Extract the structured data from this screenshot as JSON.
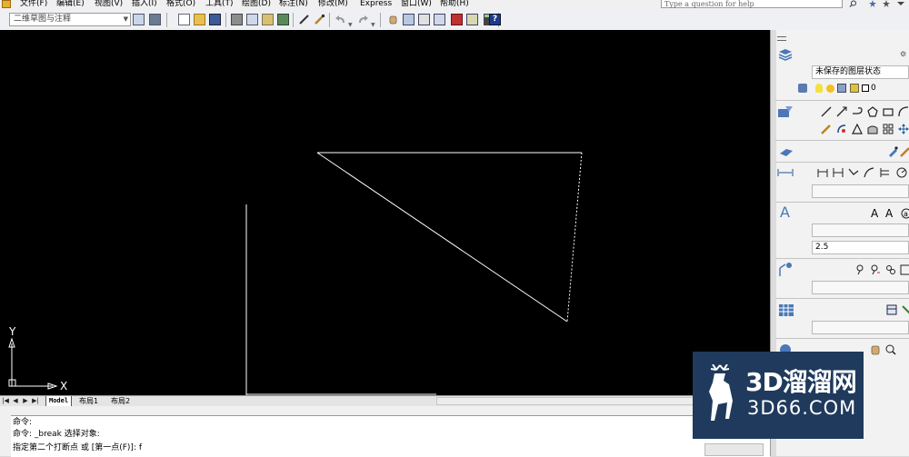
{
  "menubar": {
    "items": [
      "文件(F)",
      "编辑(E)",
      "视图(V)",
      "插入(I)",
      "格式(O)",
      "工具(T)",
      "绘图(D)",
      "标注(N)",
      "修改(M)",
      "Express",
      "窗口(W)",
      "帮助(H)"
    ],
    "help_placeholder": "Type a question for help"
  },
  "toolbar": {
    "workspace": "二维草图与注释"
  },
  "layout_tabs": {
    "items": [
      "Model",
      "布局1",
      "布局2"
    ]
  },
  "ucs": {
    "y_label": "Y",
    "x_label": "X"
  },
  "command": {
    "lines": [
      "命令:",
      "命令: _break 选择对象:",
      "指定第二个打断点 或 [第一点(F)]: f"
    ]
  },
  "palette": {
    "layer_state": "未保存的图层状态",
    "layer_current": "0",
    "text_style_icon_a": "A",
    "text_style_icon_b": "A",
    "text_height": "2.5"
  },
  "watermark": {
    "brand": "3D溜溜网",
    "url": "3D66.COM"
  },
  "colors": {
    "canvas_bg": "#000000",
    "geometry": "#ffffff",
    "watermark_bg": "#1f3a5c"
  }
}
